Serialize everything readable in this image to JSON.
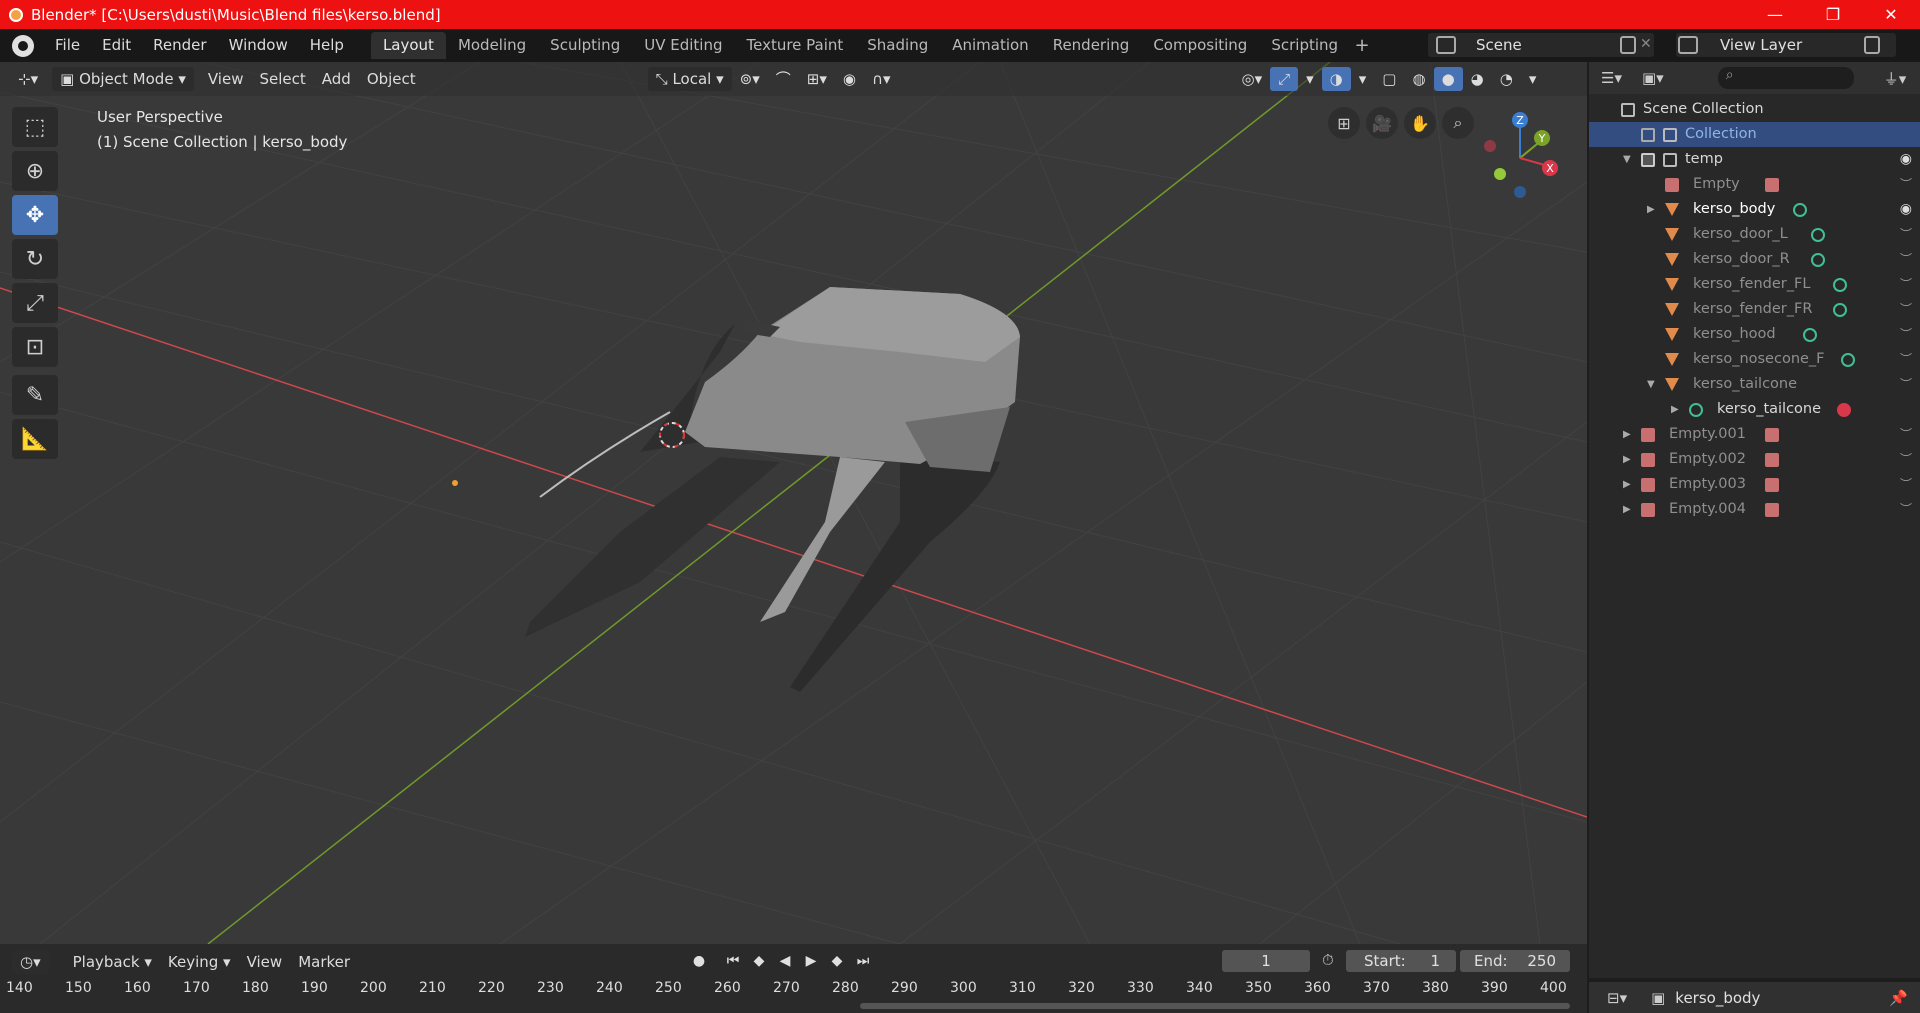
{
  "window": {
    "title": "Blender* [C:\\Users\\dusti\\Music\\Blend files\\kerso.blend]",
    "minimize": "—",
    "maximize": "❐",
    "close": "✕"
  },
  "menu": [
    "File",
    "Edit",
    "Render",
    "Window",
    "Help"
  ],
  "workspaces": [
    "Layout",
    "Modeling",
    "Sculpting",
    "UV Editing",
    "Texture Paint",
    "Shading",
    "Animation",
    "Rendering",
    "Compositing",
    "Scripting"
  ],
  "add_tab": "+",
  "scene": "Scene",
  "view_layer": "View Layer",
  "viewport_header": {
    "mode": "Object Mode",
    "view": "View",
    "select": "Select",
    "add": "Add",
    "object": "Object",
    "orientation": "Local"
  },
  "viewport_info": {
    "line1": "User Perspective",
    "line2": "(1) Scene Collection | kerso_body"
  },
  "gizmo": {
    "z": "Z",
    "y": "Y",
    "x": "X"
  },
  "outliner": {
    "root": "Scene Collection",
    "rows": [
      {
        "label": "Collection"
      },
      {
        "label": "temp"
      },
      {
        "label": "Empty"
      },
      {
        "label": "kerso_body"
      },
      {
        "label": "kerso_door_L"
      },
      {
        "label": "kerso_door_R"
      },
      {
        "label": "kerso_fender_FL"
      },
      {
        "label": "kerso_fender_FR"
      },
      {
        "label": "kerso_hood"
      },
      {
        "label": "kerso_nosecone_F"
      },
      {
        "label": "kerso_tailcone"
      },
      {
        "label": "kerso_tailcone"
      },
      {
        "label": "Empty.001"
      },
      {
        "label": "Empty.002"
      },
      {
        "label": "Empty.003"
      },
      {
        "label": "Empty.004"
      }
    ]
  },
  "properties": {
    "active_object": "kerso_body"
  },
  "timeline": {
    "playback": "Playback",
    "keying": "Keying",
    "view": "View",
    "marker": "Marker",
    "current_frame": "1",
    "start_label": "Start:",
    "start": "1",
    "end_label": "End:",
    "end": "250",
    "ruler": [
      "140",
      "150",
      "160",
      "170",
      "180",
      "190",
      "200",
      "210",
      "220",
      "230",
      "240",
      "250",
      "260",
      "270",
      "280",
      "290",
      "300",
      "310",
      "320",
      "330",
      "340",
      "350",
      "360",
      "370",
      "380",
      "390",
      "400"
    ]
  },
  "colors": {
    "title_bar": "#ee1111",
    "active_tool": "#4772b3",
    "selected_row": "#334d80",
    "x_axis": "#c94a4a",
    "y_axis": "#6f9a2a"
  }
}
